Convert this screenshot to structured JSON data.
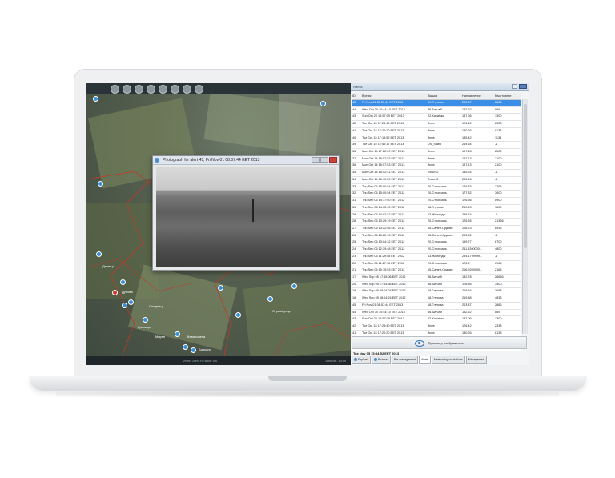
{
  "photo_window": {
    "title": "Photograph for alert 45, Fri Nov 01 08:57:44 EET 2013"
  },
  "map": {
    "status_center": "Vertex Alert-Я Tablet 5.6",
    "status_right": "Altitude: 120m",
    "labels": [
      "Дюквіці",
      "Дубова",
      "Сподківці",
      "Криниця",
      "Мирне",
      "Стримбулар",
      "Кавиловена",
      "Балкани"
    ]
  },
  "panel": {
    "title": "Alerts",
    "columns": [
      "ID",
      "Время",
      "Вышка",
      "Направление",
      "Расстояние"
    ],
    "rows": [
      [
        "45",
        "Fri Nov 01 08:57:44 EET 2013",
        "19-Глухова",
        "203.87",
        "2866"
      ],
      [
        "44",
        "Wed Oct 30 10:44:10 EET 2013",
        "36-Бигчай",
        "182.62",
        "869"
      ],
      [
        "43",
        "Sun Oct 20 16:57:09 EET 2013",
        "22-Карабаш",
        "187.06",
        "1300"
      ],
      [
        "42",
        "Tue Oct 15 17:24:40 EET 2013",
        "Знев",
        "176.42",
        "2333"
      ],
      [
        "41",
        "Tue Oct 15 17:20:20 EET 2013",
        "Знев",
        "180.26",
        "8133"
      ],
      [
        "40",
        "Tue Oct 15 17:19:52 EET 2013",
        "Знев",
        "185.42",
        "1133"
      ],
      [
        "39",
        "Tue Oct 15 12:40:17 EET 2013",
        "US_Slabo",
        "219.64",
        "-1"
      ],
      [
        "38",
        "Mon Oct 14 17:22:29 EET 2013",
        "Знев",
        "197.18",
        "2500"
      ],
      [
        "37",
        "Mon Oct 14 15:57:53 EET 2013",
        "Знев",
        "197.13",
        "2100"
      ],
      [
        "36",
        "Mon Oct 14 15:57:53 EET 2013",
        "Знев",
        "197.13",
        "2100"
      ],
      [
        "35",
        "Mon Oct 14 15:42:41 EET 2013",
        "Zeachi2",
        "185.24",
        "-1"
      ],
      [
        "34",
        "Mon Oct 14 06:10:20 EET 2013",
        "Zeachi2",
        "202.26",
        "-1"
      ],
      [
        "33",
        "Thu Sep 06 15:00:54 EET 2012",
        "20-Строгоаль",
        "176.83",
        "3766"
      ],
      [
        "32",
        "Thu Sep 06 15:00:54 EET 2012",
        "20-Строгоаль",
        "177.32",
        "3600"
      ],
      [
        "31",
        "Thu Sep 06 14:17:50 EET 2012",
        "20-Строгоаль",
        "176.66",
        "8900"
      ],
      [
        "30",
        "Thu Sep 06 14:05:45 EET 2012",
        "18-Глухова",
        "210.43",
        "9800"
      ],
      [
        "29",
        "Thu Sep 06 14:02:32 EET 2012",
        "13-Жолинды",
        "299.74",
        "-1"
      ],
      [
        "28",
        "Thu Sep 06 13:29:19 EET 2012",
        "20-Строгоаль",
        "176.65",
        "21366"
      ],
      [
        "27",
        "Thu Sep 06 13:22:56 EET 2012",
        "15-Салей-Ордово",
        "206.23",
        "8933"
      ],
      [
        "26",
        "Thu Sep 06 13:22:43 EET 2012",
        "15-Салей-Ордово",
        "205.02",
        "-1"
      ],
      [
        "25",
        "Thu Sep 06 13:04:32 EET 2012",
        "20-Строгоаль",
        "199.77",
        "6700"
      ],
      [
        "24",
        "Thu Sep 06 12:39:48 EET 2012",
        "20-Строгоаль",
        "211.9200000...",
        "4800"
      ],
      [
        "23",
        "Thu Sep 06 11:29:48 EET 2012",
        "13-Жолинды",
        "294.1799999...",
        "-1"
      ],
      [
        "22",
        "Thu Sep 06 11:27:16 EET 2012",
        "20-Строгоаль",
        "176.5",
        "6965"
      ],
      [
        "21",
        "Thu Sep 06 10:15:53 EET 2012",
        "15-Салей-Ордово",
        "206.9200000...",
        "2166"
      ],
      [
        "17",
        "Wed Sep 05 17:55:06 EET 2012",
        "36-Бигчай",
        "182.78",
        "26666"
      ],
      [
        "20",
        "Wed Sep 05 17:54:36 EET 2012",
        "36-Бигчай",
        "178.86",
        "3400"
      ],
      [
        "19",
        "Wed Sep 05 08:04:24 EET 2012",
        "18-Глухова",
        "219.34",
        "3698"
      ],
      [
        "18",
        "Wed Sep 05 08:04:24 EET 2012",
        "18-Глухова",
        "219.88",
        "4833"
      ],
      [
        "45",
        "Fri Nov 01 08:57:44 EET 2013",
        "18-Глухова",
        "203.87",
        "2866"
      ],
      [
        "44",
        "Wed Oct 30 10:44:10 EET 2013",
        "36-Бигчай",
        "182.62",
        "869"
      ],
      [
        "43",
        "Sun Oct 20 16:57:09 EET 2013",
        "22-Карабаш",
        "187.06",
        "1300"
      ],
      [
        "42",
        "Tue Oct 15 17:24:40 EET 2013",
        "Знев",
        "176.42",
        "2333"
      ],
      [
        "41",
        "Tue Oct 15 17:20:20 EET 2013",
        "Знев",
        "180.26",
        "8133"
      ],
      [
        "40",
        "Tue Oct 15 17:19:52 EET 2013",
        "Знев",
        "185.42",
        "1133"
      ],
      [
        "39",
        "Tue Oct 15 12:40:17 EET 2013",
        "US_Slabo",
        "219.64",
        "-1"
      ]
    ],
    "view_image_label": "Просмотр изображения",
    "status_datetime": "Tue Nov 05 15:34:52 EET 2013",
    "tabs": [
      "Explorer",
      "Browser",
      "Pre-management",
      "Alerts",
      "Meteorological stations",
      "Management"
    ],
    "active_tab": "Alerts"
  },
  "colors": {
    "selected_row": "#3b8ee6",
    "marker": "#3a8fd8",
    "marker_alert": "#d13a2a"
  }
}
